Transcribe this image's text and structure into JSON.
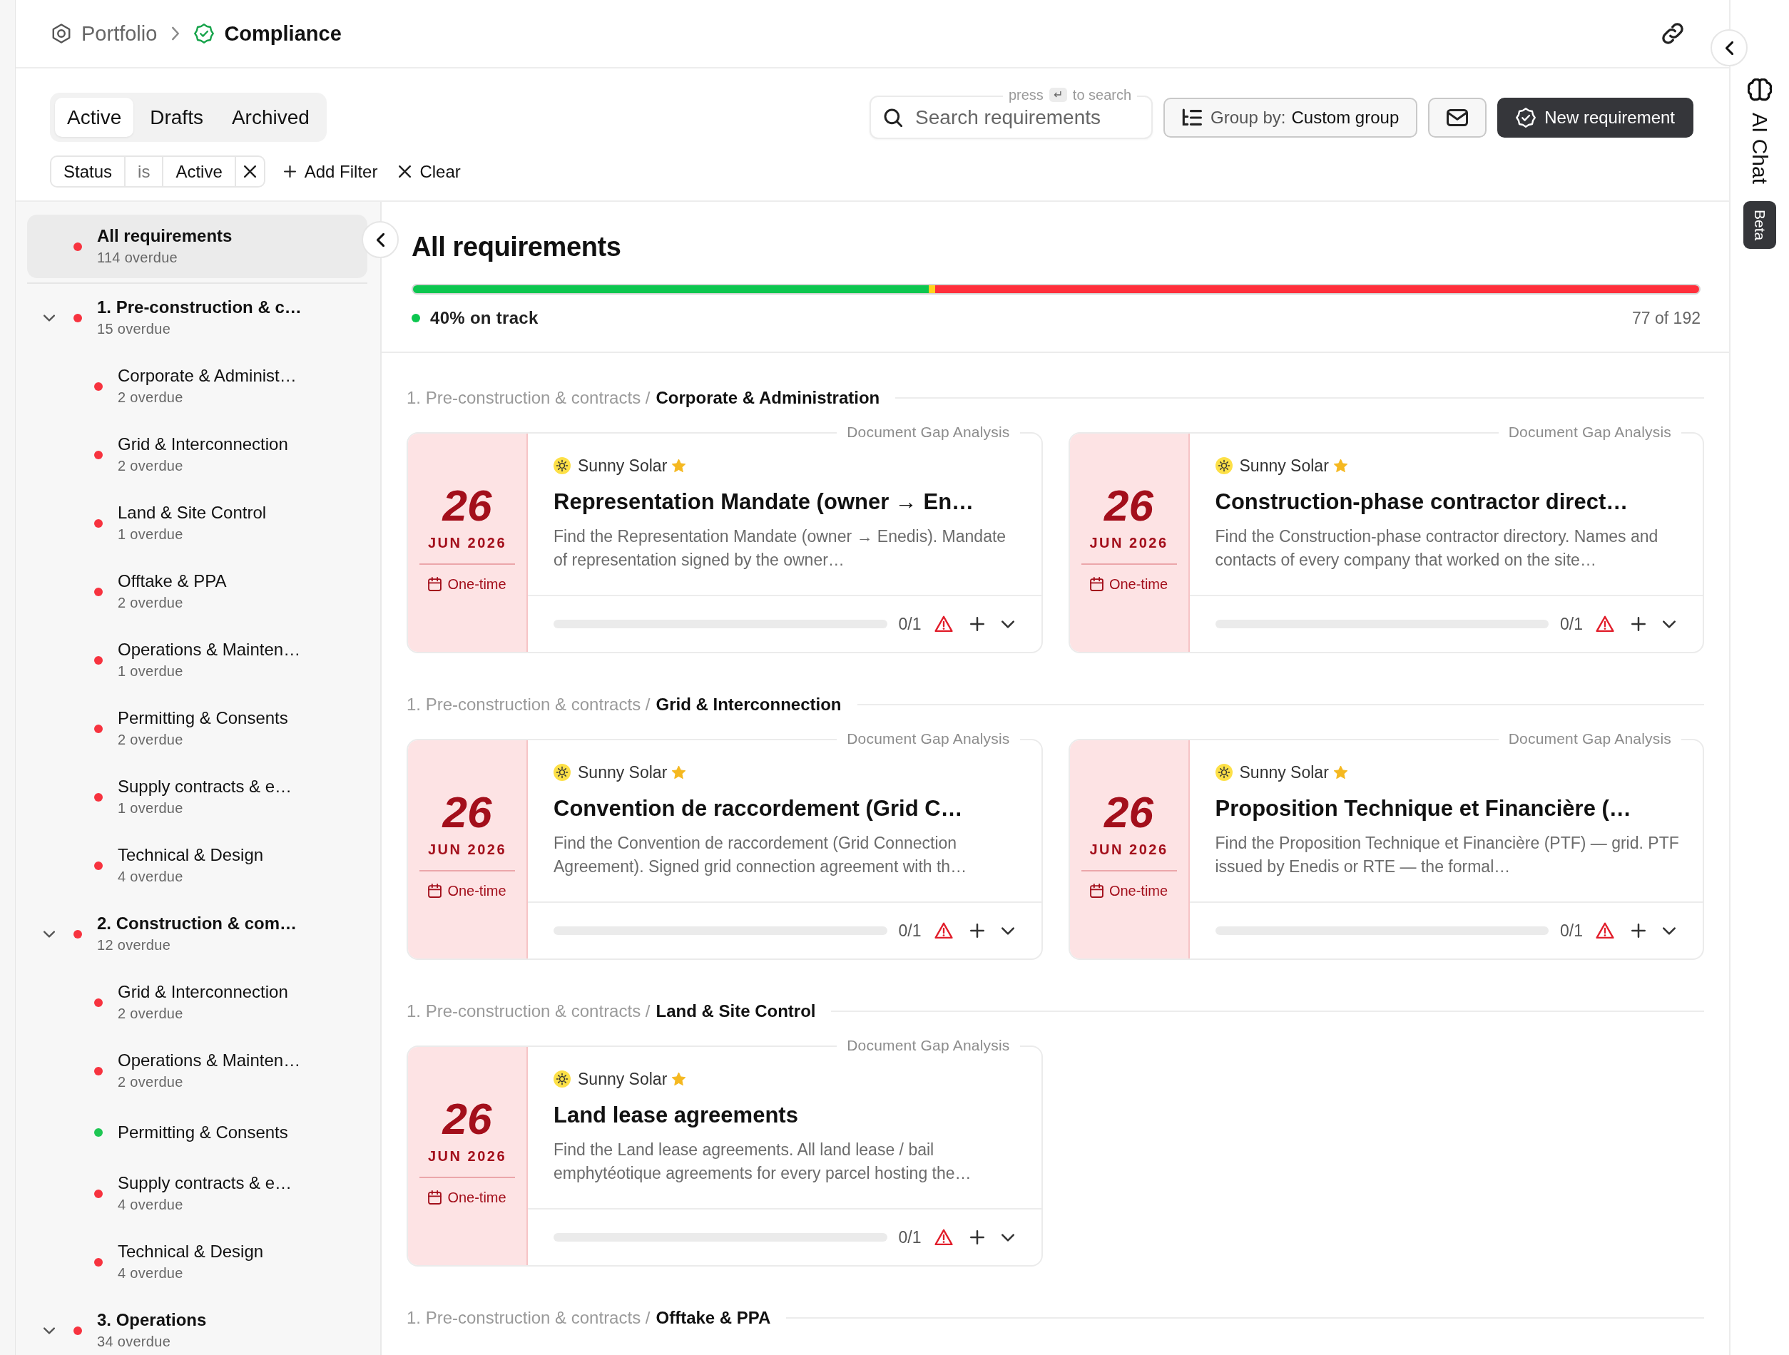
{
  "breadcrumb": [
    {
      "kind": "root",
      "label": "Portfolio"
    },
    {
      "kind": "current",
      "label": "Compliance"
    }
  ],
  "tabs": [
    {
      "label": "Active",
      "selected": true
    },
    {
      "label": "Drafts",
      "selected": false
    },
    {
      "label": "Archived",
      "selected": false
    }
  ],
  "filter": {
    "field": "Status",
    "operator": "is",
    "value": "Active"
  },
  "add_filter": "Add Filter",
  "clear": "Clear",
  "search": {
    "placeholder": "Search requirements",
    "hint_before": "press",
    "key": "↵",
    "hint_after": "to search"
  },
  "group_by": {
    "label": "Group by:",
    "value": "Custom group"
  },
  "new_button": "New requirement",
  "sidebar": {
    "items": [
      {
        "kind": "all",
        "title": "All requirements",
        "subtitle": "114 overdue",
        "color": "#f7333f",
        "selected": true
      },
      {
        "kind": "group",
        "title": "1. Pre-construction & c…",
        "subtitle": "15 overdue",
        "color": "#f7333f",
        "selected": false,
        "expanded": true,
        "children": [
          {
            "title": "Corporate & Administ…",
            "subtitle": "2 overdue",
            "color": "#f7333f",
            "selected": false
          },
          {
            "title": "Grid & Interconnection",
            "subtitle": "2 overdue",
            "color": "#f7333f",
            "selected": false
          },
          {
            "title": "Land & Site Control",
            "subtitle": "1 overdue",
            "color": "#f7333f",
            "selected": false
          },
          {
            "title": "Offtake & PPA",
            "subtitle": "2 overdue",
            "color": "#f7333f",
            "selected": false
          },
          {
            "title": "Operations & Mainten…",
            "subtitle": "1 overdue",
            "color": "#f7333f",
            "selected": false
          },
          {
            "title": "Permitting & Consents",
            "subtitle": "2 overdue",
            "color": "#f7333f",
            "selected": false
          },
          {
            "title": "Supply contracts & e…",
            "subtitle": "1 overdue",
            "color": "#f7333f",
            "selected": false
          },
          {
            "title": "Technical & Design",
            "subtitle": "4 overdue",
            "color": "#f7333f",
            "selected": false
          }
        ]
      },
      {
        "kind": "group",
        "title": "2. Construction & com…",
        "subtitle": "12 overdue",
        "color": "#f7333f",
        "selected": false,
        "expanded": true,
        "children": [
          {
            "title": "Grid & Interconnection",
            "subtitle": "2 overdue",
            "color": "#f7333f",
            "selected": false
          },
          {
            "title": "Operations & Mainten…",
            "subtitle": "2 overdue",
            "color": "#f7333f",
            "selected": false
          },
          {
            "title": "Permitting & Consents",
            "color": "#1ec653",
            "selected": false
          },
          {
            "title": "Supply contracts & e…",
            "subtitle": "4 overdue",
            "color": "#f7333f",
            "selected": false
          },
          {
            "title": "Technical & Design",
            "subtitle": "4 overdue",
            "color": "#f7333f",
            "selected": false
          }
        ]
      },
      {
        "kind": "group",
        "title": "3. Operations",
        "subtitle": "34 overdue",
        "color": "#f7333f",
        "selected": false,
        "expanded": true
      }
    ]
  },
  "heading": "All requirements",
  "progress": {
    "segments": [
      {
        "level": 0.401,
        "color": "#0cc64f"
      },
      {
        "level": 0.005,
        "color": "#ffd21c"
      },
      {
        "level": 0.594,
        "color": "#ff2f3b"
      }
    ],
    "summary": "40% on track",
    "count": "77 of 192"
  },
  "sections": [
    {
      "path": "1. Pre-construction & contracts /",
      "name": "Corporate & Administration",
      "cards": [
        {
          "source": "Document Gap Analysis",
          "overdue": true,
          "day": "26",
          "month": "JUN 2026",
          "recurrence": "One-time",
          "company": "Sunny Solar",
          "starred": true,
          "title": "Representation Mandate (owner → En…",
          "description": "Find the Representation Mandate (owner → Enedis). Mandate of representation signed by the owner…",
          "count": "0/1",
          "warning": true
        },
        {
          "source": "Document Gap Analysis",
          "overdue": true,
          "day": "26",
          "month": "JUN 2026",
          "recurrence": "One-time",
          "company": "Sunny Solar",
          "starred": true,
          "title": "Construction-phase contractor direct…",
          "description": "Find the Construction-phase contractor directory. Names and contacts of every company that worked on the site…",
          "count": "0/1",
          "warning": true
        }
      ]
    },
    {
      "path": "1. Pre-construction & contracts /",
      "name": "Grid & Interconnection",
      "cards": [
        {
          "source": "Document Gap Analysis",
          "overdue": true,
          "day": "26",
          "month": "JUN 2026",
          "recurrence": "One-time",
          "company": "Sunny Solar",
          "starred": true,
          "title": "Convention de raccordement (Grid C…",
          "description": "Find the Convention de raccordement (Grid Connection Agreement). Signed grid connection agreement with th…",
          "count": "0/1",
          "warning": true
        },
        {
          "source": "Document Gap Analysis",
          "overdue": true,
          "day": "26",
          "month": "JUN 2026",
          "recurrence": "One-time",
          "company": "Sunny Solar",
          "starred": true,
          "title": "Proposition Technique et Financière (…",
          "description": "Find the Proposition Technique et Financière (PTF) — grid. PTF issued by Enedis or RTE — the formal…",
          "count": "0/1",
          "warning": true
        }
      ]
    },
    {
      "path": "1. Pre-construction & contracts /",
      "name": "Land & Site Control",
      "cards": [
        {
          "source": "Document Gap Analysis",
          "overdue": true,
          "day": "26",
          "month": "JUN 2026",
          "recurrence": "One-time",
          "company": "Sunny Solar",
          "starred": true,
          "title": "Land lease agreements",
          "description": "Find the Land lease agreements. All land lease / bail emphytéotique agreements for every parcel hosting the…",
          "count": "0/1",
          "warning": true
        }
      ]
    },
    {
      "path": "1. Pre-construction & contracts /",
      "name": "Offtake & PPA"
    }
  ],
  "ai_chat": {
    "label": "AI Chat",
    "badge": "Beta"
  }
}
